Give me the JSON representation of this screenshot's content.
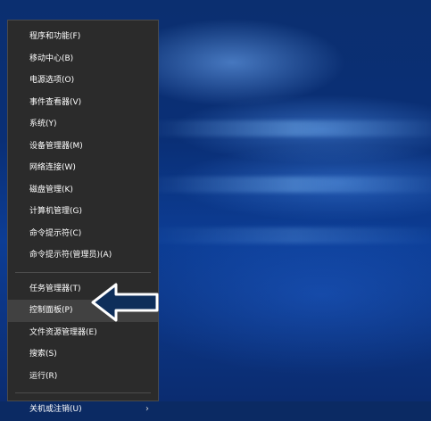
{
  "menu": {
    "items": [
      {
        "label": "程序和功能(F)"
      },
      {
        "label": "移动中心(B)"
      },
      {
        "label": "电源选项(O)"
      },
      {
        "label": "事件查看器(V)"
      },
      {
        "label": "系统(Y)"
      },
      {
        "label": "设备管理器(M)"
      },
      {
        "label": "网络连接(W)"
      },
      {
        "label": "磁盘管理(K)"
      },
      {
        "label": "计算机管理(G)"
      },
      {
        "label": "命令提示符(C)"
      },
      {
        "label": "命令提示符(管理员)(A)"
      }
    ],
    "items2": [
      {
        "label": "任务管理器(T)"
      },
      {
        "label": "控制面板(P)"
      },
      {
        "label": "文件资源管理器(E)"
      },
      {
        "label": "搜索(S)"
      },
      {
        "label": "运行(R)"
      }
    ],
    "items3": [
      {
        "label": "关机或注销(U)",
        "submenu_icon": "chevron-right-icon"
      }
    ],
    "highlighted": "控制面板(P)"
  },
  "annotation": {
    "icon": "left-arrow-pointer-icon",
    "color": "#0e2e5a"
  }
}
